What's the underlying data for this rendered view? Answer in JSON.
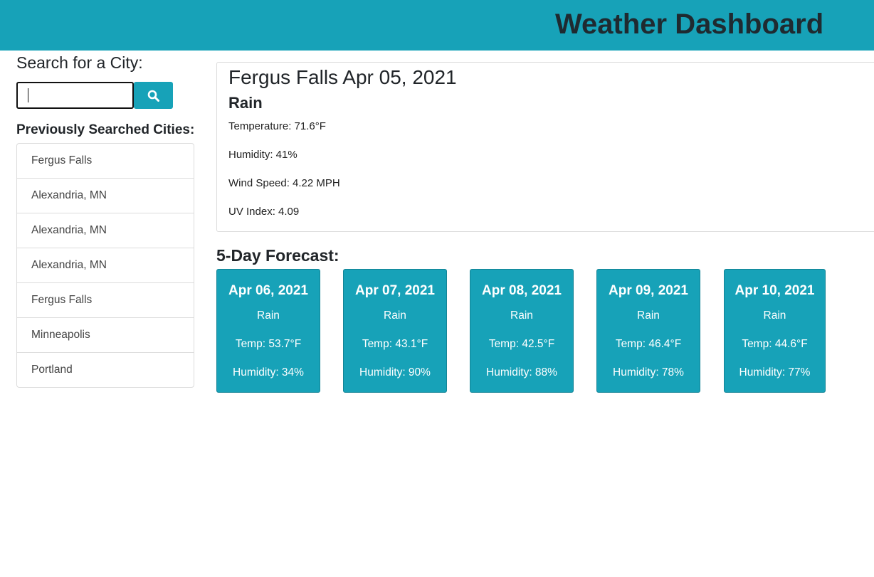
{
  "header": {
    "title": "Weather Dashboard"
  },
  "search": {
    "label": "Search for a City:",
    "value": "",
    "placeholder": "",
    "button_icon": "search-icon"
  },
  "history": {
    "label": "Previously Searched Cities:",
    "items": [
      "Fergus Falls",
      "Alexandria, MN",
      "Alexandria, MN",
      "Alexandria, MN",
      "Fergus Falls",
      "Minneapolis",
      "Portland"
    ]
  },
  "current": {
    "city_date": "Fergus Falls Apr 05, 2021",
    "condition": "Rain",
    "temperature": "Temperature: 71.6°F",
    "humidity": "Humidity: 41%",
    "wind": "Wind Speed: 4.22 MPH",
    "uv": "UV Index: 4.09"
  },
  "forecast": {
    "title": "5-Day Forecast:",
    "days": [
      {
        "date": "Apr 06, 2021",
        "condition": "Rain",
        "temp": "Temp: 53.7°F",
        "humidity": "Humidity: 34%"
      },
      {
        "date": "Apr 07, 2021",
        "condition": "Rain",
        "temp": "Temp: 43.1°F",
        "humidity": "Humidity: 90%"
      },
      {
        "date": "Apr 08, 2021",
        "condition": "Rain",
        "temp": "Temp: 42.5°F",
        "humidity": "Humidity: 88%"
      },
      {
        "date": "Apr 09, 2021",
        "condition": "Rain",
        "temp": "Temp: 46.4°F",
        "humidity": "Humidity: 78%"
      },
      {
        "date": "Apr 10, 2021",
        "condition": "Rain",
        "temp": "Temp: 44.6°F",
        "humidity": "Humidity: 77%"
      }
    ]
  },
  "colors": {
    "accent": "#17a2b8",
    "header_text": "#1f2a30"
  }
}
